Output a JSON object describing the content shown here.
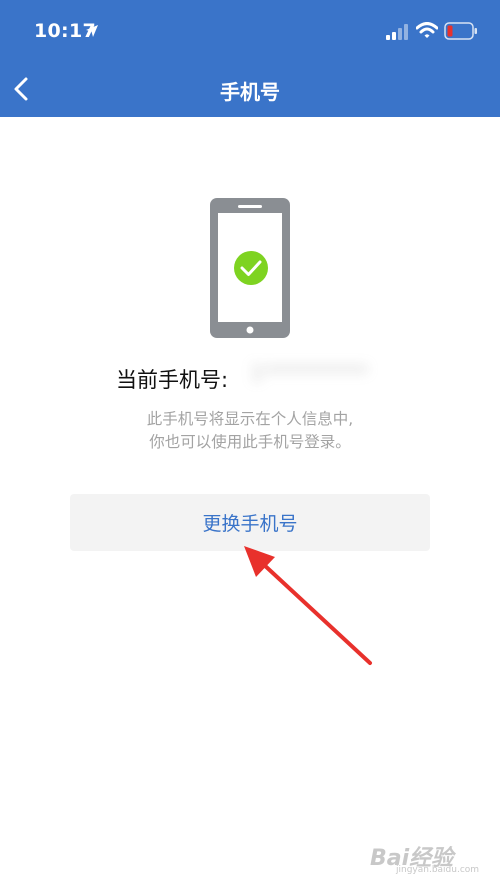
{
  "status_bar": {
    "time": "10:17",
    "icons": [
      "location-arrow-icon",
      "signal-icon",
      "wifi-icon",
      "battery-low-icon"
    ]
  },
  "nav": {
    "title": "手机号",
    "back_icon": "chevron-left-icon"
  },
  "main": {
    "illustration": "phone-check-icon",
    "current_phone_label": "当前手机号:",
    "current_phone_value": "1**********",
    "description_line1": "此手机号将显示在个人信息中,",
    "description_line2": "你也可以使用此手机号登录。",
    "change_button_label": "更换手机号"
  },
  "watermark": {
    "brand": "Bai经验",
    "sub": "jingyan.baidu.com"
  },
  "colors": {
    "primary": "#3a74c9",
    "check_green": "#7ed321",
    "arrow_red": "#e8312c",
    "phone_gray": "#8a8e93"
  }
}
